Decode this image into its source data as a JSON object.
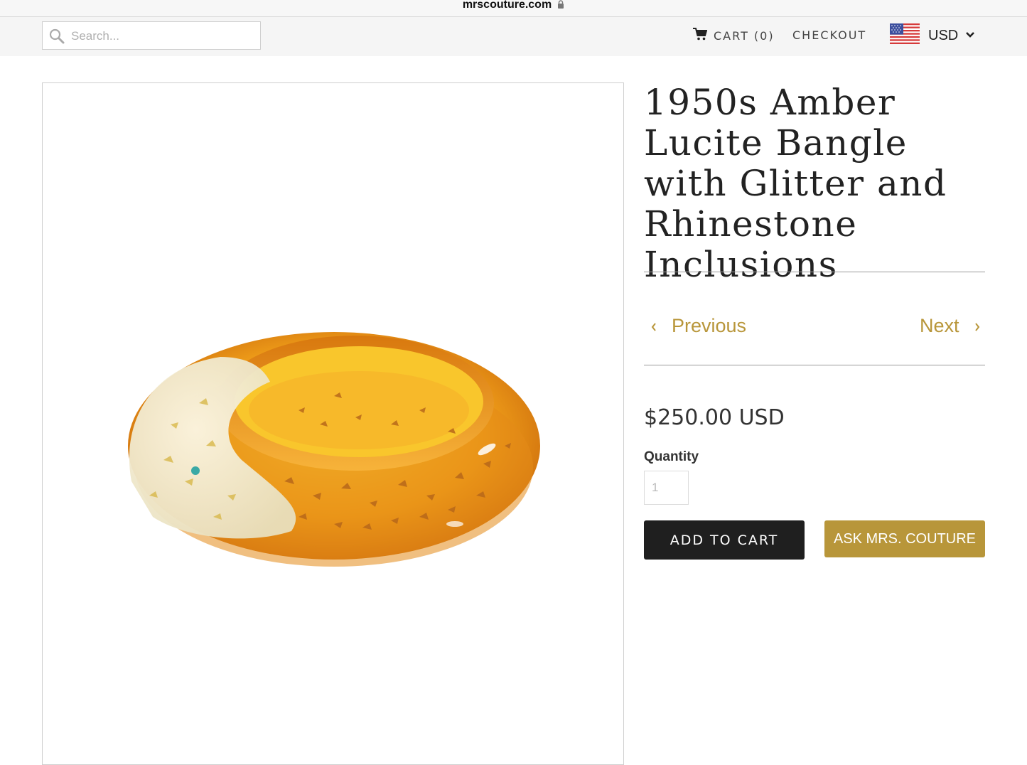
{
  "browser": {
    "url": "mrscouture.com"
  },
  "header": {
    "search_placeholder": "Search...",
    "cart_label": "CART (0)",
    "checkout_label": "CHECKOUT",
    "currency_code": "USD"
  },
  "product": {
    "title": "1950s Amber Lucite Bangle with Glitter and Rhinestone Inclusions",
    "price": "$250.00 USD",
    "quantity_label": "Quantity",
    "quantity_value": "1",
    "add_to_cart_label": "ADD TO CART",
    "ask_label": "ASK MRS. COUTURE"
  },
  "pagination": {
    "previous_label": "Previous",
    "next_label": "Next"
  },
  "colors": {
    "accent": "#b8963a",
    "button_dark": "#1f1f1f",
    "amber": "#e7951b"
  }
}
